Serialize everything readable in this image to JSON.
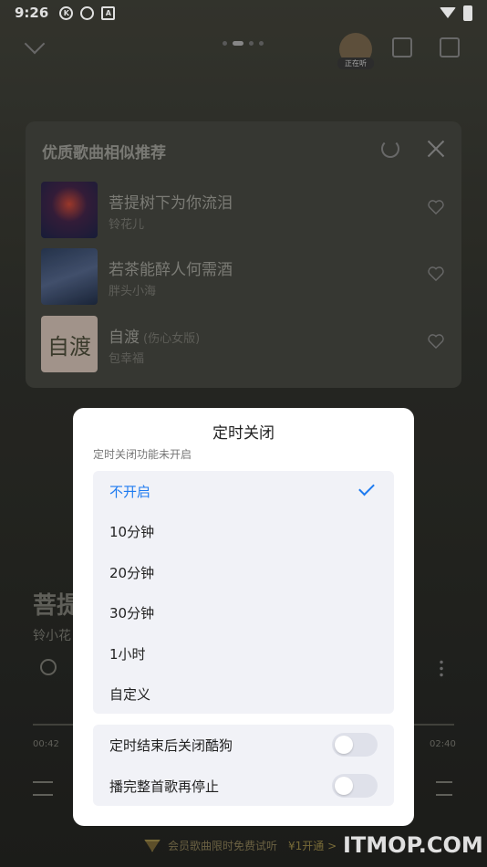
{
  "status_bar": {
    "time": "9:26",
    "icon1": "K",
    "icon3": "A"
  },
  "header": {
    "listening_label": "正在听"
  },
  "recommend": {
    "title": "优质歌曲相似推荐",
    "items": [
      {
        "name": "菩提树下为你流泪",
        "subtitle": "",
        "artist": "铃花儿"
      },
      {
        "name": "若茶能醉人何需酒",
        "subtitle": "",
        "artist": "胖头小海"
      },
      {
        "name": "自渡",
        "subtitle": "(伤心女版)",
        "artist": "包幸福",
        "cover_text": "自渡"
      }
    ]
  },
  "background_song": {
    "title": "菩提",
    "artist": "铃小花",
    "time_elapsed": "00:42",
    "time_total": "02:40"
  },
  "promo": {
    "text": "会员歌曲限时免费试听",
    "cta": "¥1开通 >"
  },
  "watermark": "ITMOP.COM",
  "dialog": {
    "title": "定时关闭",
    "subtitle": "定时关闭功能未开启",
    "options": [
      "不开启",
      "10分钟",
      "20分钟",
      "30分钟",
      "1小时",
      "自定义"
    ],
    "selected_index": 0,
    "toggles": [
      {
        "label": "定时结束后关闭酷狗",
        "on": false
      },
      {
        "label": "播完整首歌再停止",
        "on": false
      }
    ]
  },
  "colors": {
    "accent": "#1e7bf0",
    "dialog_bg": "#ffffff",
    "option_bg": "#f1f2f7"
  }
}
